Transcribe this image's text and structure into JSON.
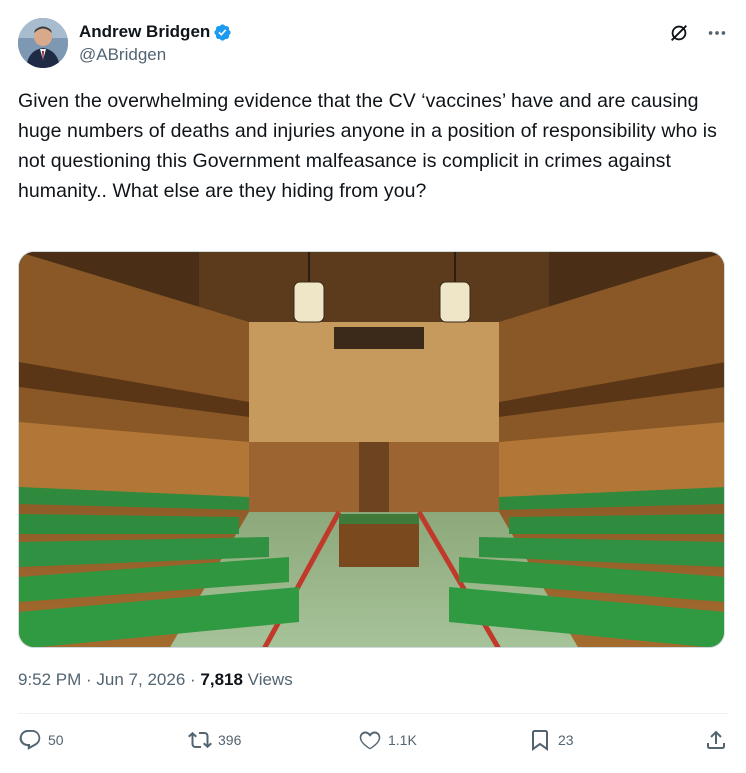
{
  "author": {
    "display_name": "Andrew Bridgen",
    "handle": "@ABridgen",
    "verified": true,
    "verified_color": "#1d9bf0",
    "avatar_icon": "profile-photo"
  },
  "tweet": {
    "text": "Given the overwhelming evidence that the CV ‘vaccines’ have and are causing huge numbers of deaths and injuries anyone in a position of responsibility who is not questioning this Government malfeasance is complicit in crimes against humanity.. What else are they hiding from you?",
    "image_icon": "house-of-commons-chamber-photo"
  },
  "meta": {
    "time": "9:52 PM",
    "separator": " · ",
    "date": "Jun 7, 2026",
    "views_count": "7,818",
    "views_label": " Views"
  },
  "actions": {
    "replies": "50",
    "reposts": "396",
    "likes": "1.1K",
    "bookmarks": "23"
  },
  "icons": {
    "header": [
      "grok-icon",
      "more-icon"
    ],
    "actions": [
      "reply-icon",
      "repost-icon",
      "like-icon",
      "bookmark-icon",
      "share-icon"
    ]
  },
  "colors": {
    "text_primary": "#0f1419",
    "text_secondary": "#536471",
    "border": "#cfd9de"
  }
}
